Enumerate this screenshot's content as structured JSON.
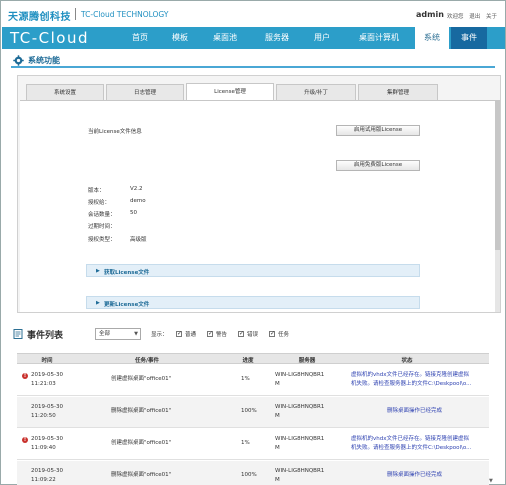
{
  "header": {
    "brand_cn": "天源腾创科技",
    "brand_en": "TC-Cloud TECHNOLOGY",
    "user": "admin",
    "links": [
      "欢迎您",
      "退出",
      "关于"
    ]
  },
  "nav": {
    "brand": "TC-Cloud",
    "items": [
      "首页",
      "模板",
      "桌面池",
      "服务器",
      "用户",
      "桌面计算机",
      "系统",
      "事件"
    ],
    "active": "系统"
  },
  "system": {
    "title": "系统功能",
    "tabs": [
      "系统设置",
      "日志管理",
      "License管理",
      "升级/补丁",
      "集群管理"
    ],
    "active_tab": "License管理"
  },
  "license": {
    "current_info_label": "当前License文件信息",
    "btn_trial": "启用试用版License",
    "btn_free": "启用免费版License",
    "fields": [
      {
        "label": "版本：",
        "value": "V2.2"
      },
      {
        "label": "授权给：",
        "value": "demo"
      },
      {
        "label": "会话数量：",
        "value": "50"
      },
      {
        "label": "过期时间：",
        "value": ""
      },
      {
        "label": "授权类型：",
        "value": "高级版"
      }
    ],
    "get_file": "获取License文件",
    "update_file": "更新License文件"
  },
  "events": {
    "title": "事件列表",
    "filter_value": "全部",
    "show_label": "显示：",
    "filters": [
      "普通",
      "警告",
      "错误",
      "任务"
    ],
    "columns": [
      "时间",
      "任务/事件",
      "进度",
      "服务器",
      "状态"
    ],
    "rows": [
      {
        "error": true,
        "time_1": "2019-05-30",
        "time_2": "11:21:03",
        "task": "创建虚拟桌面\"office01\"",
        "progress": "1%",
        "server_1": "WIN-LIG8HNQBR1",
        "server_2": "M",
        "status_1": "虚拟机的vhdx文件已经存在。链接克隆创建虚拟",
        "status_2": "机失败。请检查服务器上的文件C:\\Deskpool\\o..."
      },
      {
        "error": false,
        "time_1": "2019-05-30",
        "time_2": "11:20:50",
        "task": "删除虚拟桌面\"office01\"",
        "progress": "100%",
        "server_1": "WIN-LIG8HNQBR1",
        "server_2": "M",
        "status_1": "删除桌面操作已经完成",
        "status_2": ""
      },
      {
        "error": true,
        "time_1": "2019-05-30",
        "time_2": "11:09:40",
        "task": "创建虚拟桌面\"office01\"",
        "progress": "1%",
        "server_1": "WIN-LIG8HNQBR1",
        "server_2": "M",
        "status_1": "虚拟机的vhdx文件已经存在。链接克隆创建虚拟",
        "status_2": "机失败。请检查服务器上的文件C:\\Deskpool\\o..."
      },
      {
        "error": false,
        "time_1": "2019-05-30",
        "time_2": "11:09:22",
        "task": "删除虚拟桌面\"office01\"",
        "progress": "100%",
        "server_1": "WIN-LIG8HNQBR1",
        "server_2": "M",
        "status_1": "删除桌面操作已经完成",
        "status_2": ""
      }
    ]
  }
}
